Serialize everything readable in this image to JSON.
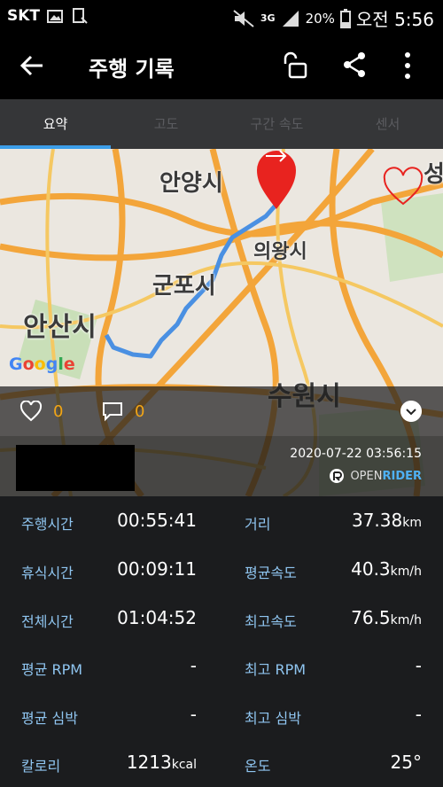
{
  "status_bar": {
    "carrier": "SKT",
    "battery": "20%",
    "network": "3G",
    "time_period": "오전",
    "time": "5:56"
  },
  "app_bar": {
    "title": "주행 기록"
  },
  "tabs": [
    {
      "label": "요약",
      "active": true
    },
    {
      "label": "고도",
      "active": false
    },
    {
      "label": "구간 속도",
      "active": false
    },
    {
      "label": "센서",
      "active": false
    }
  ],
  "map": {
    "labels": [
      "안양시",
      "의왕시",
      "군포시",
      "안산시",
      "수원시",
      "성"
    ],
    "attribution": [
      "G",
      "o",
      "o",
      "g",
      "l",
      "e"
    ],
    "route_color": "#4a90e2",
    "marker_color": "#e8231f"
  },
  "social": {
    "likes": "0",
    "comments": "0"
  },
  "record": {
    "datetime": "2020-07-22 03:56:15",
    "brand_open": "OPEN",
    "brand_rider": "RIDER"
  },
  "stats": [
    {
      "left_label": "주행시간",
      "left_value": "00:55:41",
      "left_unit": "",
      "right_label": "거리",
      "right_value": "37.38",
      "right_unit": "km"
    },
    {
      "left_label": "휴식시간",
      "left_value": "00:09:11",
      "left_unit": "",
      "right_label": "평균속도",
      "right_value": "40.3",
      "right_unit": "km/h"
    },
    {
      "left_label": "전체시간",
      "left_value": "01:04:52",
      "left_unit": "",
      "right_label": "최고속도",
      "right_value": "76.5",
      "right_unit": "km/h"
    },
    {
      "left_label": "평균 RPM",
      "left_value": "-",
      "left_unit": "",
      "right_label": "최고 RPM",
      "right_value": "-",
      "right_unit": ""
    },
    {
      "left_label": "평균 심박",
      "left_value": "-",
      "left_unit": "",
      "right_label": "최고 심박",
      "right_value": "-",
      "right_unit": ""
    },
    {
      "left_label": "칼로리",
      "left_value": "1213",
      "left_unit": "kcal",
      "right_label": "온도",
      "right_value": "25°",
      "right_unit": ""
    }
  ]
}
